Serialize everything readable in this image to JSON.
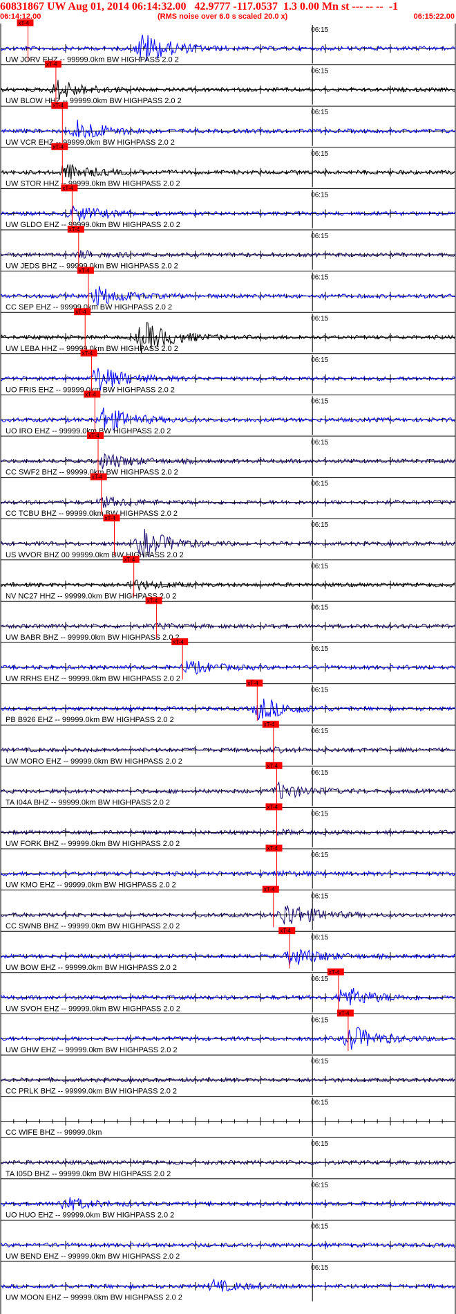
{
  "header": {
    "title": "60831867 UW Aug 01, 2014 06:14:32.00   42.9777 -117.0537  1.3 0.00 Mn st --- -- --  -1",
    "start_time": "06:14:12.00",
    "note": "(RMS noise over 6.0 s scaled 20.0 x)",
    "end_time": "06:15:22.00"
  },
  "colors": {
    "header": "#ff0000",
    "blue": "#0000ff",
    "black": "#000000",
    "navy": "#1a0a6e",
    "pick": "#ff0000"
  },
  "chart_data": {
    "type": "line",
    "title": "60831867 UW Aug 01, 2014 06:14:32.00   42.9777 -117.0537  1.3 0.00 Mn st --- -- --  -1",
    "x_range": [
      "06:14:12.00",
      "06:15:22.00"
    ],
    "minute_label": "06:15",
    "pick_label": "xT-4",
    "traces": [
      {
        "label": "UW JORV EHZ -- 99999.0km BW  HIGHPASS  2.0  2",
        "color": "blue",
        "pick_s": 4.2,
        "event_s": 22,
        "event_amp": 1.0
      },
      {
        "label": "UW BLOW HHZ -- 99999.0km BW  HIGHPASS  2.0  2",
        "color": "black",
        "pick_s": 8.5,
        "event_s": 9.0,
        "event_amp": 0.6
      },
      {
        "label": "UW VCR EHZ -- 99999.0km BW  HIGHPASS  2.0  2",
        "color": "blue",
        "pick_s": 9.5,
        "event_s": 12,
        "event_amp": 0.7
      },
      {
        "label": "UW STOR HHZ -- 99999.0km BW  HIGHPASS  2.0  2",
        "color": "black",
        "pick_s": 9.5,
        "event_s": 10,
        "event_amp": 0.5
      },
      {
        "label": "UW GLDO EHZ -- 99999.0km BW  HIGHPASS  2.0  2",
        "color": "blue",
        "pick_s": 11.0,
        "event_s": 11.5,
        "event_amp": 0.5
      },
      {
        "label": "UW JEDS BHZ -- 99999.0km BW  HIGHPASS  2.0  2",
        "color": "navy",
        "pick_s": 12.0,
        "event_s": 12.5,
        "event_amp": 0.2
      },
      {
        "label": "CC SEP EHZ -- 99999.0km BW  HIGHPASS  2.0  2",
        "color": "blue",
        "pick_s": 13.5,
        "event_s": 15,
        "event_amp": 0.6
      },
      {
        "label": "UW LEBA HHZ -- 99999.0km BW  HIGHPASS  2.0  2",
        "color": "black",
        "pick_s": 13.0,
        "event_s": 22,
        "event_amp": 1.0
      },
      {
        "label": "UO FRIS EHZ -- 99999.0km BW  HIGHPASS  2.0  2",
        "color": "blue",
        "pick_s": 14.0,
        "event_s": 15,
        "event_amp": 0.8
      },
      {
        "label": "UO IRO EHZ -- 99999.0km BW  HIGHPASS  2.0  2",
        "color": "blue",
        "pick_s": 14.5,
        "event_s": 16,
        "event_amp": 0.8
      },
      {
        "label": "CC SWF2 BHZ -- 99999.0km BW  HIGHPASS  2.0  2",
        "color": "navy",
        "pick_s": 15.0,
        "event_s": 16,
        "event_amp": 0.5
      },
      {
        "label": "CC TCBU BHZ -- 99999.0km BW  HIGHPASS  2.0  2",
        "color": "navy",
        "pick_s": 15.5,
        "event_s": 16,
        "event_amp": 0.3
      },
      {
        "label": "US WVOR BHZ 00 99999.0km BW  HIGHPASS  2.0  2",
        "color": "navy",
        "pick_s": 17.5,
        "event_s": 22,
        "event_amp": 0.9
      },
      {
        "label": "NV NC27 HHZ -- 99999.0km BW  HIGHPASS  2.0  2",
        "color": "black",
        "pick_s": 20.5,
        "event_s": 20.5,
        "event_amp": 0.3
      },
      {
        "label": "UW BABR BHZ -- 99999.0km BW  HIGHPASS  2.0  2",
        "color": "navy",
        "pick_s": 24.0,
        "event_s": 24,
        "event_amp": 0.1
      },
      {
        "label": "UW RRHS EHZ -- 99999.0km BW  HIGHPASS  2.0  2",
        "color": "blue",
        "pick_s": 28.0,
        "event_s": 29,
        "event_amp": 0.4
      },
      {
        "label": "PB B926 EHZ -- 99999.0km BW  HIGHPASS  2.0  2",
        "color": "blue",
        "pick_s": 39.5,
        "event_s": 40,
        "event_amp": 0.7
      },
      {
        "label": "UW MORO EHZ -- 99999.0km BW  HIGHPASS  2.0  2",
        "color": "navy",
        "pick_s": 42.0,
        "event_s": 42,
        "event_amp": 0.1
      },
      {
        "label": "TA I04A BHZ -- 99999.0km BW  HIGHPASS  2.0  2",
        "color": "navy",
        "pick_s": 42.5,
        "event_s": 43,
        "event_amp": 0.5
      },
      {
        "label": "UW FORK BHZ -- 99999.0km BW  HIGHPASS  2.0  2",
        "color": "navy",
        "pick_s": 42.5,
        "event_s": 43,
        "event_amp": 0.1
      },
      {
        "label": "UW KMO EHZ -- 99999.0km BW  HIGHPASS  2.0  2",
        "color": "blue",
        "pick_s": 42.5,
        "event_s": 43,
        "event_amp": 0.1
      },
      {
        "label": "CC SWNB BHZ -- 99999.0km BW  HIGHPASS  2.0  2",
        "color": "navy",
        "pick_s": 42.0,
        "event_s": 44,
        "event_amp": 0.8
      },
      {
        "label": "UW BOW EHZ -- 99999.0km BW  HIGHPASS  2.0  2",
        "color": "blue",
        "pick_s": 44.5,
        "event_s": 45,
        "event_amp": 0.6
      },
      {
        "label": "UW SVOH EHZ -- 99999.0km BW  HIGHPASS  2.0  2",
        "color": "blue",
        "pick_s": 52.0,
        "event_s": 53,
        "event_amp": 0.7
      },
      {
        "label": "UW GHW EHZ -- 99999.0km BW  HIGHPASS  2.0  2",
        "color": "blue",
        "pick_s": 53.5,
        "event_s": 54,
        "event_amp": 0.8
      },
      {
        "label": "CC PRLK BHZ -- 99999.0km BW  HIGHPASS  2.0  2",
        "color": "navy",
        "pick_s": null,
        "event_s": null,
        "event_amp": 0
      },
      {
        "label": "CC WIFE BHZ -- 99999.0km",
        "color": "none",
        "pick_s": null,
        "event_s": null,
        "event_amp": 0
      },
      {
        "label": "TA I05D BHZ -- 99999.0km BW  HIGHPASS  2.0  2",
        "color": "navy",
        "pick_s": null,
        "event_s": null,
        "event_amp": 0
      },
      {
        "label": "UO HUO EHZ -- 99999.0km BW  HIGHPASS  2.0  2",
        "color": "blue",
        "pick_s": null,
        "event_s": 10,
        "event_amp": 0.4
      },
      {
        "label": "UW BEND EHZ -- 99999.0km BW  HIGHPASS  2.0  2",
        "color": "blue",
        "pick_s": null,
        "event_s": null,
        "event_amp": 0
      },
      {
        "label": "UW MOON EHZ -- 99999.0km BW  HIGHPASS  2.0  2",
        "color": "blue",
        "pick_s": null,
        "event_s": 33,
        "event_amp": 0.35
      }
    ]
  }
}
